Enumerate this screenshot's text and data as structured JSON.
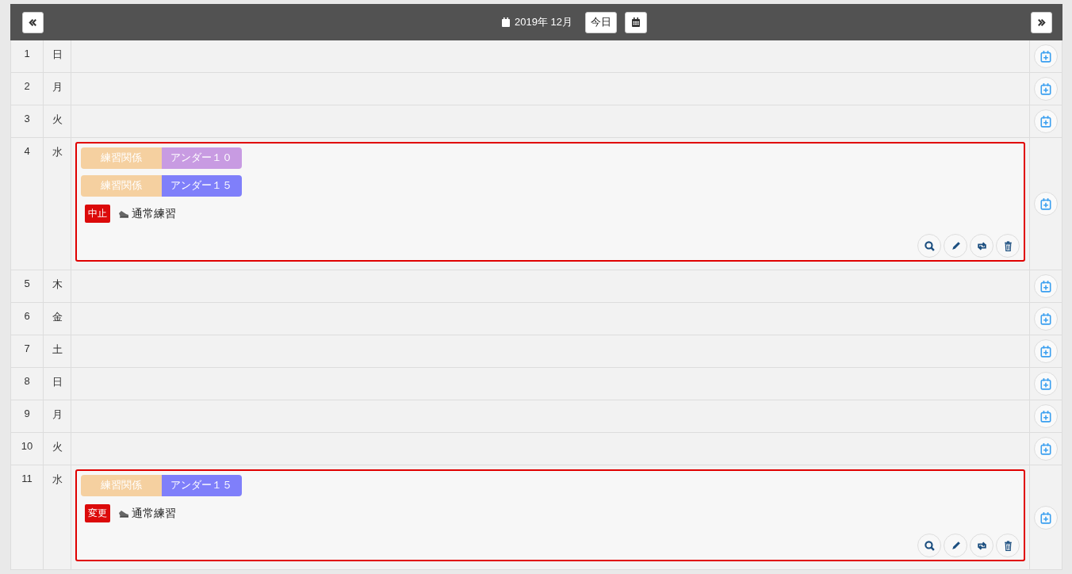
{
  "header": {
    "month": "2019年 12月",
    "today_button": "今日"
  },
  "days": [
    {
      "day": "1",
      "weekday": "日"
    },
    {
      "day": "2",
      "weekday": "月"
    },
    {
      "day": "3",
      "weekday": "火"
    },
    {
      "day": "4",
      "weekday": "水",
      "events": [
        {
          "tags": [
            {
              "category": "練習関係",
              "group": "アンダー１０",
              "color": "#c89be2"
            },
            {
              "category": "練習関係",
              "group": "アンダー１５",
              "color": "#7f7ffa"
            }
          ],
          "status": "中止",
          "title": "通常練習"
        }
      ]
    },
    {
      "day": "5",
      "weekday": "木"
    },
    {
      "day": "6",
      "weekday": "金"
    },
    {
      "day": "7",
      "weekday": "土"
    },
    {
      "day": "8",
      "weekday": "日"
    },
    {
      "day": "9",
      "weekday": "月"
    },
    {
      "day": "10",
      "weekday": "火"
    },
    {
      "day": "11",
      "weekday": "水",
      "events": [
        {
          "tags": [
            {
              "category": "練習関係",
              "group": "アンダー１５",
              "color": "#7f7ffa"
            }
          ],
          "status": "変更",
          "title": "通常練習"
        }
      ]
    }
  ]
}
